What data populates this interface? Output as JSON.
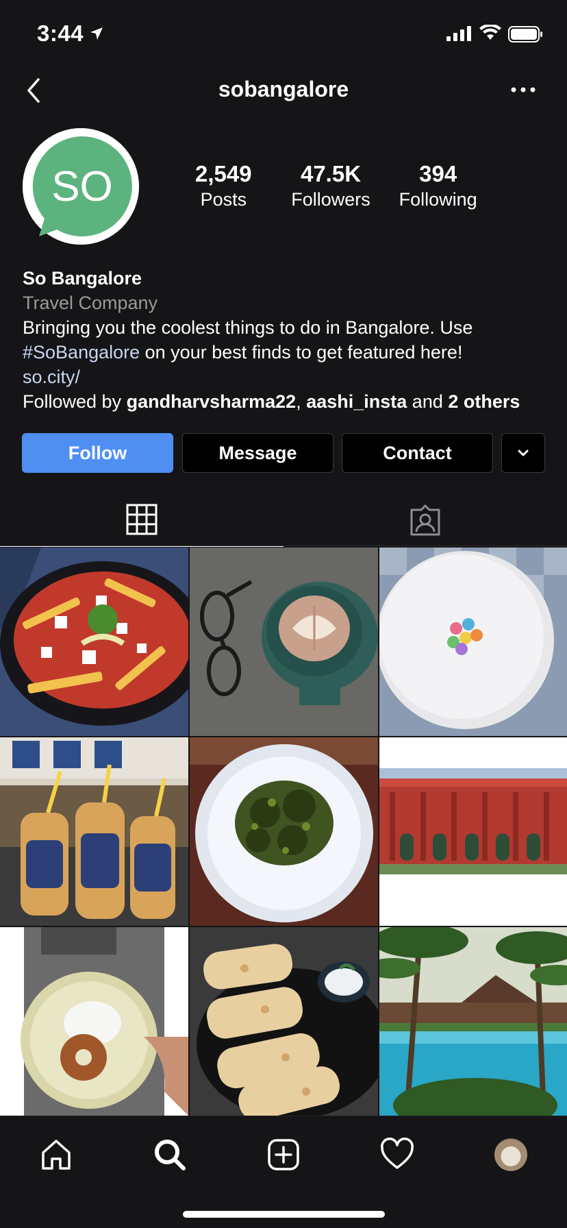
{
  "status_bar": {
    "time": "3:44"
  },
  "nav": {
    "title": "sobangalore"
  },
  "avatar": {
    "initials": "SO",
    "brand_color": "#5db37e"
  },
  "stats": [
    {
      "value": "2,549",
      "label": "Posts"
    },
    {
      "value": "47.5K",
      "label": "Followers"
    },
    {
      "value": "394",
      "label": "Following"
    }
  ],
  "bio": {
    "name": "So Bangalore",
    "category": "Travel Company",
    "line1": "Bringing you the coolest things to do in Bangalore. Use",
    "hashtag": "#SoBangalore",
    "line2_rest": " on your best finds to get featured here!",
    "link": "so.city/",
    "followed_by_prefix": "Followed by ",
    "followed_user1": "gandharvsharma22",
    "sep": ", ",
    "followed_user2": "aashi_insta",
    "and": " and ",
    "others": "2 others"
  },
  "actions": {
    "follow": "Follow",
    "message": "Message",
    "contact": "Contact"
  },
  "colors": {
    "accent": "#4f8ff2",
    "background": "#151417"
  },
  "posts": [
    {
      "subject": "loaded fries"
    },
    {
      "subject": "latte art and glasses"
    },
    {
      "subject": "cotton candy with cereal"
    },
    {
      "subject": "keventers shakes"
    },
    {
      "subject": "green chicken on paper plate"
    },
    {
      "subject": "red heritage building"
    },
    {
      "subject": "idli vada"
    },
    {
      "subject": "garlic bread with dip"
    },
    {
      "subject": "resort pool with palms"
    }
  ]
}
